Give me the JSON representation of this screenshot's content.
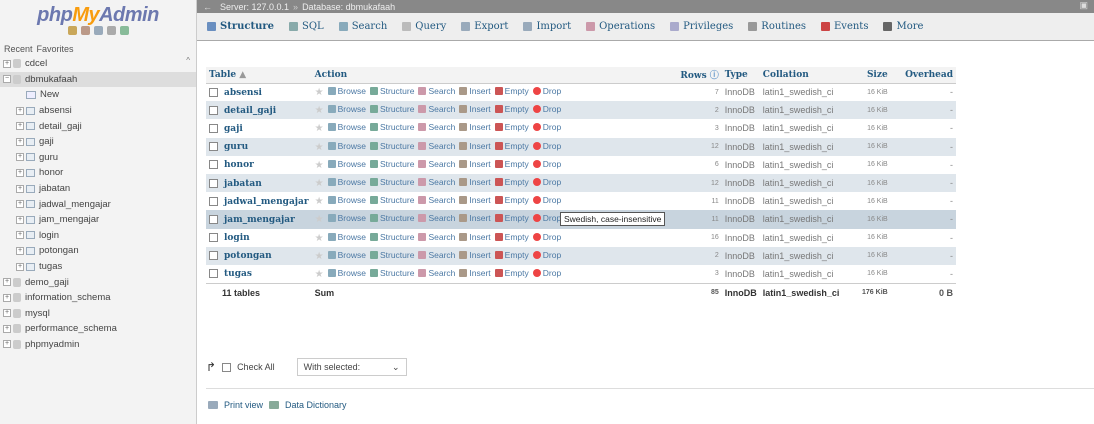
{
  "sidebar": {
    "logo": {
      "php": "php",
      "my": "My",
      "admin": "Admin"
    },
    "recent": "Recent",
    "favorites": "Favorites",
    "tree": [
      {
        "label": "cdcel",
        "level": 0,
        "kind": "db"
      },
      {
        "label": "dbmukafaah",
        "level": 0,
        "kind": "db",
        "selected": true
      },
      {
        "label": "New",
        "level": 1,
        "kind": "new"
      },
      {
        "label": "absensi",
        "level": 1,
        "kind": "table"
      },
      {
        "label": "detail_gaji",
        "level": 1,
        "kind": "table"
      },
      {
        "label": "gaji",
        "level": 1,
        "kind": "table"
      },
      {
        "label": "guru",
        "level": 1,
        "kind": "table"
      },
      {
        "label": "honor",
        "level": 1,
        "kind": "table"
      },
      {
        "label": "jabatan",
        "level": 1,
        "kind": "table"
      },
      {
        "label": "jadwal_mengajar",
        "level": 1,
        "kind": "table"
      },
      {
        "label": "jam_mengajar",
        "level": 1,
        "kind": "table"
      },
      {
        "label": "login",
        "level": 1,
        "kind": "table"
      },
      {
        "label": "potongan",
        "level": 1,
        "kind": "table"
      },
      {
        "label": "tugas",
        "level": 1,
        "kind": "table"
      },
      {
        "label": "demo_gaji",
        "level": 0,
        "kind": "db"
      },
      {
        "label": "information_schema",
        "level": 0,
        "kind": "db"
      },
      {
        "label": "mysql",
        "level": 0,
        "kind": "db"
      },
      {
        "label": "performance_schema",
        "level": 0,
        "kind": "db"
      },
      {
        "label": "phpmyadmin",
        "level": 0,
        "kind": "db"
      }
    ]
  },
  "topbar": {
    "server": "Server: 127.0.0.1",
    "database": "Database: dbmukafaah"
  },
  "tabs": [
    {
      "label": "Structure",
      "icon": "structure-icon",
      "color": "#6a8fc0",
      "active": true
    },
    {
      "label": "SQL",
      "icon": "sql-icon",
      "color": "#8aa"
    },
    {
      "label": "Search",
      "icon": "search-icon",
      "color": "#8ab"
    },
    {
      "label": "Query",
      "icon": "query-icon",
      "color": "#bbb"
    },
    {
      "label": "Export",
      "icon": "export-icon",
      "color": "#9ab"
    },
    {
      "label": "Import",
      "icon": "import-icon",
      "color": "#9ab"
    },
    {
      "label": "Operations",
      "icon": "wrench-icon",
      "color": "#c9a"
    },
    {
      "label": "Privileges",
      "icon": "privileges-icon",
      "color": "#aac"
    },
    {
      "label": "Routines",
      "icon": "routines-icon",
      "color": "#999"
    },
    {
      "label": "Events",
      "icon": "clock-icon",
      "color": "#c44"
    },
    {
      "label": "More",
      "icon": "chevron-down-icon",
      "color": "#666"
    }
  ],
  "table_headers": {
    "table": "Table",
    "action": "Action",
    "rows": "Rows",
    "type": "Type",
    "collation": "Collation",
    "size": "Size",
    "overhead": "Overhead"
  },
  "actions": [
    "Browse",
    "Structure",
    "Search",
    "Insert",
    "Empty",
    "Drop"
  ],
  "rows": [
    {
      "name": "absensi",
      "rows": "7",
      "type": "InnoDB",
      "collation": "latin1_swedish_ci",
      "size": "16 KiB",
      "overhead": "-"
    },
    {
      "name": "detail_gaji",
      "rows": "2",
      "type": "InnoDB",
      "collation": "latin1_swedish_ci",
      "size": "16 KiB",
      "overhead": "-"
    },
    {
      "name": "gaji",
      "rows": "3",
      "type": "InnoDB",
      "collation": "latin1_swedish_ci",
      "size": "16 KiB",
      "overhead": "-"
    },
    {
      "name": "guru",
      "rows": "12",
      "type": "InnoDB",
      "collation": "latin1_swedish_ci",
      "size": "16 KiB",
      "overhead": "-"
    },
    {
      "name": "honor",
      "rows": "6",
      "type": "InnoDB",
      "collation": "latin1_swedish_ci",
      "size": "16 KiB",
      "overhead": "-"
    },
    {
      "name": "jabatan",
      "rows": "12",
      "type": "InnoDB",
      "collation": "latin1_swedish_ci",
      "size": "16 KiB",
      "overhead": "-"
    },
    {
      "name": "jadwal_mengajar",
      "rows": "11",
      "type": "InnoDB",
      "collation": "latin1_swedish_ci",
      "size": "16 KiB",
      "overhead": "-"
    },
    {
      "name": "jam_mengajar",
      "rows": "11",
      "type": "InnoDB",
      "collation": "latin1_swedish_ci",
      "size": "16 KiB",
      "overhead": "-"
    },
    {
      "name": "login",
      "rows": "16",
      "type": "InnoDB",
      "collation": "latin1_swedish_ci",
      "size": "16 KiB",
      "overhead": "-"
    },
    {
      "name": "potongan",
      "rows": "2",
      "type": "InnoDB",
      "collation": "latin1_swedish_ci",
      "size": "16 KiB",
      "overhead": "-"
    },
    {
      "name": "tugas",
      "rows": "3",
      "type": "InnoDB",
      "collation": "latin1_swedish_ci",
      "size": "16 KiB",
      "overhead": "-"
    }
  ],
  "summary": {
    "count": "11 tables",
    "label": "Sum",
    "rows": "85",
    "type": "InnoDB",
    "collation": "latin1_swedish_ci",
    "size": "176 KiB",
    "overhead": "0 B"
  },
  "tooltip": "Swedish, case-insensitive",
  "controls": {
    "check_all": "Check All",
    "with_selected": "With selected:"
  },
  "footer": {
    "print_view": "Print view",
    "data_dictionary": "Data Dictionary"
  }
}
